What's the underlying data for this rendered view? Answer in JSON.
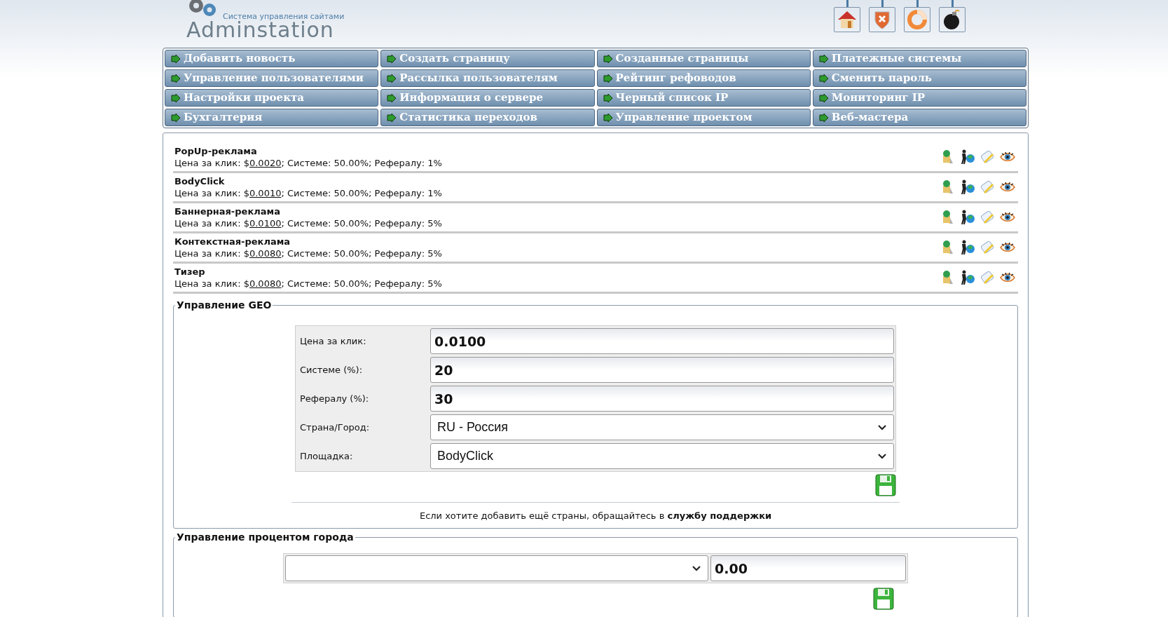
{
  "logo": {
    "name": "Adminstation",
    "tagline": "Система управления сайтами"
  },
  "menu": [
    {
      "label": "Добавить новость"
    },
    {
      "label": "Создать страницу"
    },
    {
      "label": "Созданные страницы"
    },
    {
      "label": "Платежные системы"
    },
    {
      "label": "Управление пользователями"
    },
    {
      "label": "Рассылка пользователям"
    },
    {
      "label": "Рейтинг рефоводов"
    },
    {
      "label": "Сменить пароль"
    },
    {
      "label": "Настройки проекта"
    },
    {
      "label": "Информация о сервере"
    },
    {
      "label": "Черный список IP"
    },
    {
      "label": "Мониторинг IP"
    },
    {
      "label": "Бухгалтерия"
    },
    {
      "label": "Статистика переходов"
    },
    {
      "label": "Управление проектом"
    },
    {
      "label": "Веб-мастера"
    }
  ],
  "ad_types": [
    {
      "title": "PopUp-реклама",
      "before": "Цена за клик: $",
      "price": "0.0020",
      "after": "; Системе: 50.00%; Рефералу: 1%"
    },
    {
      "title": "BodyClick",
      "before": "Цена за клик: $",
      "price": "0.0010",
      "after": "; Системе: 50.00%; Рефералу: 1%"
    },
    {
      "title": "Баннерная-реклама",
      "before": "Цена за клик: $",
      "price": "0.0100",
      "after": "; Системе: 50.00%; Рефералу: 5%"
    },
    {
      "title": "Контекстная-реклама",
      "before": "Цена за клик: $",
      "price": "0.0080",
      "after": "; Системе: 50.00%; Рефералу: 5%"
    },
    {
      "title": "Тизер",
      "before": "Цена за клик: $",
      "price": "0.0080",
      "after": "; Системе: 50.00%; Рефералу: 5%"
    }
  ],
  "geo": {
    "legend": "Управление GEO",
    "fields": [
      {
        "kind": "input",
        "label": "Цена за клик:",
        "value": "0.0100"
      },
      {
        "kind": "input",
        "label": "Системе (%):",
        "value": "20"
      },
      {
        "kind": "input",
        "label": "Рефералу (%):",
        "value": "30"
      },
      {
        "kind": "select",
        "label": "Страна/Город:",
        "value": "RU - Россия"
      },
      {
        "kind": "select",
        "label": "Площадка:",
        "value": "BodyClick"
      }
    ],
    "note": {
      "text": "Если хотите добавить ещё страны, обращайтесь в",
      "link": "службу поддержки"
    }
  },
  "city": {
    "legend": "Управление процентом города",
    "percent": "0.00"
  }
}
